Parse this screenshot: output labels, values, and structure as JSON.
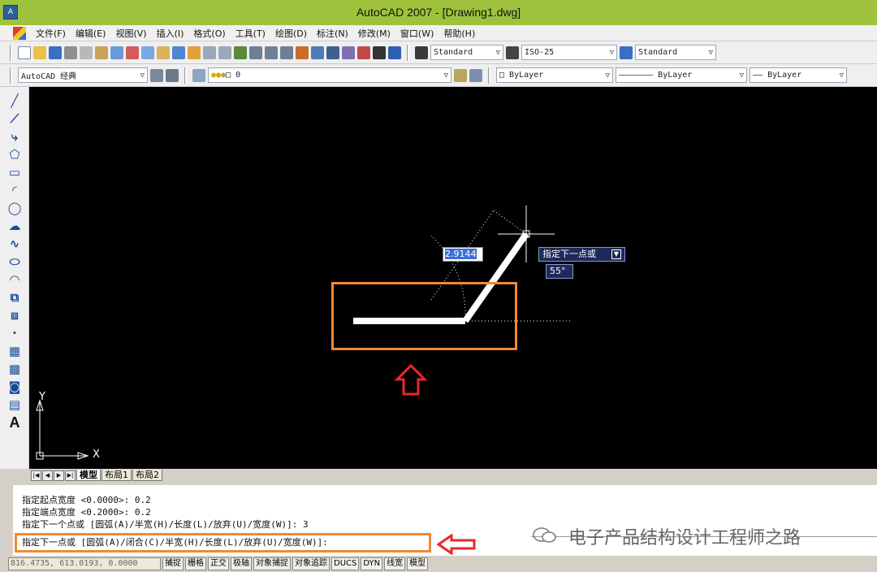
{
  "window": {
    "title": "AutoCAD 2007 - [Drawing1.dwg]",
    "app_icon": "autocad-app-icon"
  },
  "menu": [
    "文件(F)",
    "编辑(E)",
    "视图(V)",
    "插入(I)",
    "格式(O)",
    "工具(T)",
    "绘图(D)",
    "标注(N)",
    "修改(M)",
    "窗口(W)",
    "帮助(H)"
  ],
  "toolbar": {
    "text_style": "Standard",
    "dim_style": "ISO-25",
    "table_style": "Standard",
    "workspace": "AutoCAD 经典",
    "layer": "0",
    "color": "ByLayer",
    "linetype": "ByLayer",
    "lineweight": "ByLayer"
  },
  "draw_tools": [
    "line-icon",
    "construction-line-icon",
    "polyline-icon",
    "polygon-icon",
    "rectangle-icon",
    "arc-icon",
    "circle-icon",
    "revcloud-icon",
    "spline-icon",
    "ellipse-icon",
    "ellipse-arc-icon",
    "insert-block-icon",
    "make-block-icon",
    "point-icon",
    "hatch-icon",
    "gradient-icon",
    "region-icon",
    "table-icon"
  ],
  "draw_text_tool": "A",
  "canvas": {
    "dynamic_input_value": "2.9144",
    "dynamic_prompt": "指定下一点或",
    "dynamic_angle": "55°",
    "ucs_x": "X",
    "ucs_y": "Y"
  },
  "layout_tabs": [
    "模型",
    "布局1",
    "布局2"
  ],
  "command_lines": [
    "指定起点宽度 <0.0000>: 0.2",
    "指定端点宽度 <0.2000>: 0.2",
    "指定下一个点或 [圆弧(A)/半宽(H)/长度(L)/放弃(U)/宽度(W)]: 3",
    "指定下一点或 [圆弧(A)/闭合(C)/半宽(H)/长度(L)/放弃(U)/宽度(W)]:"
  ],
  "watermark": "电子产品结构设计工程师之路",
  "status": {
    "coords": "816.4735, 613.0193, 0.0000",
    "buttons": [
      "捕捉",
      "栅格",
      "正交",
      "极轴",
      "对象捕捉",
      "对象追踪",
      "DUCS",
      "DYN",
      "线宽",
      "模型"
    ]
  },
  "colors": {
    "highlight_orange": "#f08a30",
    "arrow_red": "#e8282a",
    "titlebar_green": "#9ec23c",
    "canvas_black": "#000000"
  }
}
